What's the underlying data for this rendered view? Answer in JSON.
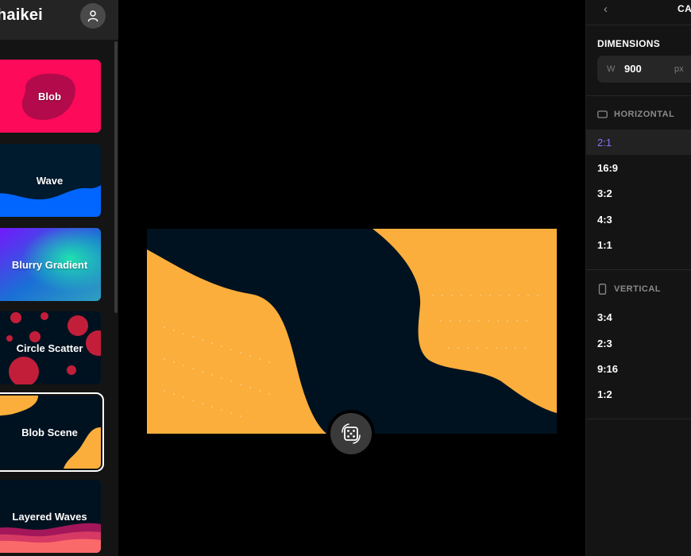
{
  "app": {
    "logo_text": "haikei"
  },
  "sidebar": {
    "items": [
      {
        "label": "Blob"
      },
      {
        "label": "Wave"
      },
      {
        "label": "Blurry Gradient"
      },
      {
        "label": "Circle Scatter"
      },
      {
        "label": "Blob Scene",
        "selected": true
      },
      {
        "label": "Layered Waves"
      }
    ]
  },
  "colors": {
    "blob_bg": "#fe0a5a",
    "blob_shape": "#b30a4b",
    "wave_bg": "#001a2e",
    "wave_shape": "#0066ff",
    "scatter_bg": "#001220",
    "scatter_dot": "#c21e3a",
    "scene_bg": "#001220",
    "scene_shape": "#fbae3c",
    "preview_dark": "#001220",
    "preview_orange": "#fbae3c",
    "accent": "#8b72ff"
  },
  "right_panel": {
    "title": "CA",
    "dimensions_title": "DIMENSIONS",
    "width": {
      "label": "W",
      "value": "900",
      "unit": "px"
    },
    "horizontal": {
      "title": "HORIZONTAL",
      "ratios": [
        "2:1",
        "16:9",
        "3:2",
        "4:3",
        "1:1"
      ],
      "active": "2:1"
    },
    "vertical": {
      "title": "VERTICAL",
      "ratios": [
        "3:4",
        "2:3",
        "9:16",
        "1:2"
      ]
    }
  },
  "icons": {
    "back": "chevron-left-icon",
    "avatar": "user-icon",
    "dice": "dice-icon",
    "horizontal": "landscape-rect-icon",
    "vertical": "portrait-rect-icon"
  }
}
